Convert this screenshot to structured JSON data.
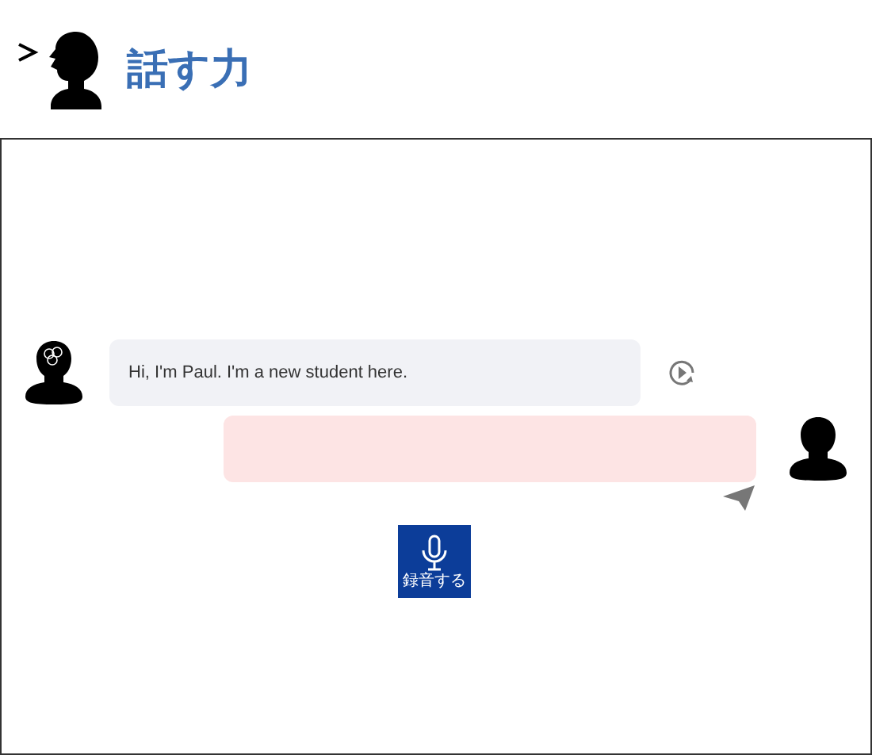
{
  "header": {
    "title": "話す力"
  },
  "messages": [
    {
      "kind": "partner",
      "text": "Hi, I'm Paul. I'm a new student here."
    },
    {
      "kind": "user"
    }
  ],
  "record_button": {
    "label": "録音する"
  }
}
